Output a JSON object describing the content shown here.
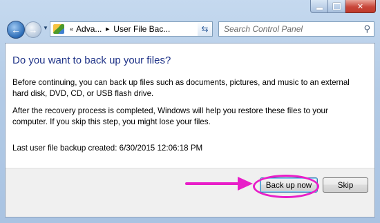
{
  "window": {
    "caption_buttons": [
      "minimize",
      "maximize",
      "close"
    ]
  },
  "navbar": {
    "breadcrumb": [
      {
        "label": "Adva..."
      },
      {
        "label": "User File Bac..."
      }
    ],
    "breadcrumb_prefix": "«",
    "breadcrumb_separator": "►",
    "search_placeholder": "Search Control Panel"
  },
  "content": {
    "title": "Do you want to back up your files?",
    "paragraph1": "Before continuing, you can back up files such as documents, pictures, and music to an external hard disk, DVD, CD, or USB flash drive.",
    "paragraph2": "After the recovery process is completed, Windows will help you restore these files to  your computer.  If you skip this step, you might lose your files.",
    "last_backup": "Last user file backup created:  6/30/2015 12:06:18 PM"
  },
  "buttons": {
    "backup_label": "Back up now",
    "skip_label": "Skip"
  },
  "annotation": {
    "color": "#e81ec8"
  },
  "colors": {
    "title": "#1e3287",
    "close_button": "#c8473a"
  }
}
